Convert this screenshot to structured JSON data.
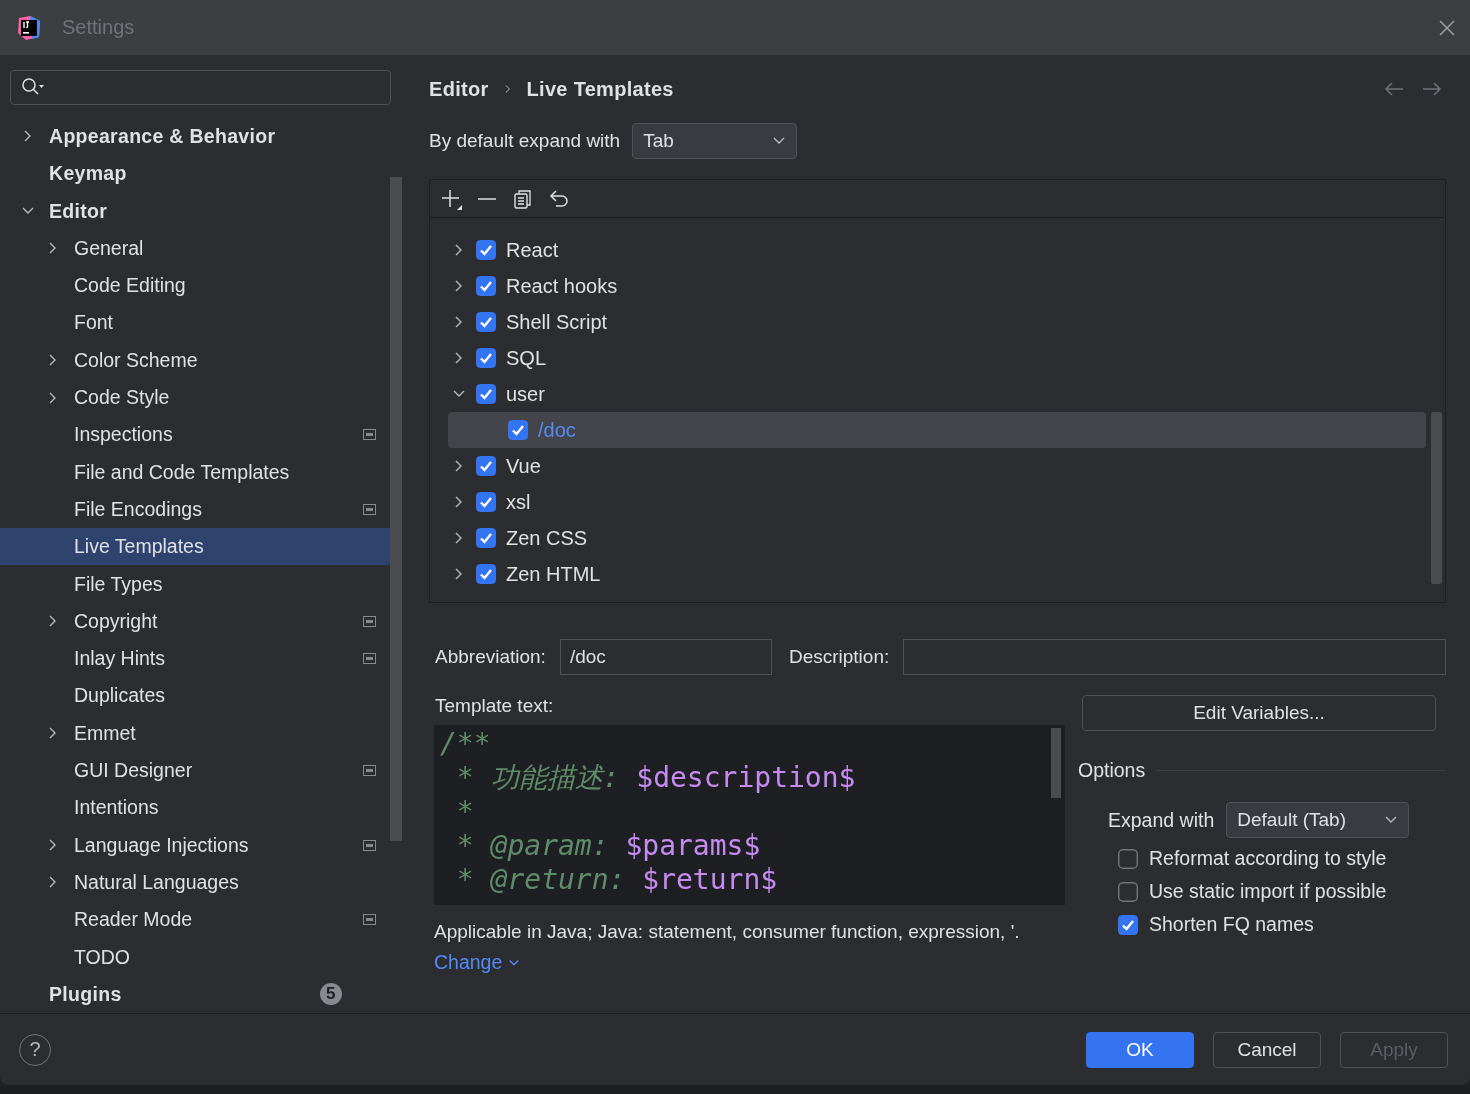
{
  "window": {
    "title": "Settings"
  },
  "sidebar": {
    "items": [
      {
        "label": "Appearance & Behavior",
        "expanded": false,
        "selected": false
      },
      {
        "label": "Keymap",
        "selected": false
      },
      {
        "label": "Editor",
        "expanded": true,
        "selected": false,
        "children": [
          {
            "label": "General",
            "expanded": false,
            "selected": false,
            "project_level": false
          },
          {
            "label": "Code Editing",
            "selected": false,
            "project_level": false
          },
          {
            "label": "Font",
            "selected": false,
            "project_level": false
          },
          {
            "label": "Color Scheme",
            "expanded": false,
            "selected": false,
            "project_level": false
          },
          {
            "label": "Code Style",
            "expanded": false,
            "selected": false,
            "project_level": false
          },
          {
            "label": "Inspections",
            "selected": false,
            "project_level": true
          },
          {
            "label": "File and Code Templates",
            "selected": false,
            "project_level": false
          },
          {
            "label": "File Encodings",
            "selected": false,
            "project_level": true
          },
          {
            "label": "Live Templates",
            "selected": true,
            "project_level": false
          },
          {
            "label": "File Types",
            "selected": false,
            "project_level": false
          },
          {
            "label": "Copyright",
            "expanded": false,
            "selected": false,
            "project_level": true
          },
          {
            "label": "Inlay Hints",
            "selected": false,
            "project_level": true
          },
          {
            "label": "Duplicates",
            "selected": false,
            "project_level": false
          },
          {
            "label": "Emmet",
            "expanded": false,
            "selected": false,
            "project_level": false
          },
          {
            "label": "GUI Designer",
            "selected": false,
            "project_level": true
          },
          {
            "label": "Intentions",
            "selected": false,
            "project_level": false
          },
          {
            "label": "Language Injections",
            "expanded": false,
            "selected": false,
            "project_level": true
          },
          {
            "label": "Natural Languages",
            "expanded": false,
            "selected": false,
            "project_level": false
          },
          {
            "label": "Reader Mode",
            "selected": false,
            "project_level": true
          },
          {
            "label": "TODO",
            "selected": false,
            "project_level": false
          }
        ]
      },
      {
        "label": "Plugins",
        "selected": false,
        "badge": "5"
      }
    ]
  },
  "breadcrumb": [
    "Editor",
    "Live Templates"
  ],
  "expand_default": {
    "label": "By default expand with",
    "value": "Tab"
  },
  "templates": [
    {
      "label": "React",
      "checked": true,
      "expanded": false,
      "selected": false
    },
    {
      "label": "React hooks",
      "checked": true,
      "expanded": false,
      "selected": false
    },
    {
      "label": "Shell Script",
      "checked": true,
      "expanded": false,
      "selected": false
    },
    {
      "label": "SQL",
      "checked": true,
      "expanded": false,
      "selected": false
    },
    {
      "label": "user",
      "checked": true,
      "expanded": true,
      "selected": false,
      "children": [
        {
          "label": "/doc",
          "checked": true,
          "selected": true
        }
      ]
    },
    {
      "label": "Vue",
      "checked": true,
      "expanded": false,
      "selected": false
    },
    {
      "label": "xsl",
      "checked": true,
      "expanded": false,
      "selected": false
    },
    {
      "label": "Zen CSS",
      "checked": true,
      "expanded": false,
      "selected": false
    },
    {
      "label": "Zen HTML",
      "checked": true,
      "expanded": false,
      "selected": false
    }
  ],
  "abbreviation": {
    "label": "Abbreviation:",
    "value": "/doc"
  },
  "description": {
    "label": "Description:"
  },
  "template_text": {
    "label": "Template text:",
    "lines": [
      [
        {
          "kind": "comment",
          "text": "/**"
        }
      ],
      [
        {
          "kind": "comment",
          "text": " * 功能描述: "
        },
        {
          "kind": "variable",
          "text": "$description$"
        }
      ],
      [
        {
          "kind": "comment",
          "text": " *"
        }
      ],
      [
        {
          "kind": "comment",
          "text": " * @param: "
        },
        {
          "kind": "variable",
          "text": "$params$"
        }
      ],
      [
        {
          "kind": "comment",
          "text": " * @return: "
        },
        {
          "kind": "variable",
          "text": "$return$"
        }
      ]
    ]
  },
  "edit_variables": "Edit Variables...",
  "options": {
    "title": "Options",
    "expand_label": "Expand with",
    "expand_value": "Default (Tab)",
    "checkboxes": [
      {
        "label": "Reformat according to style",
        "checked": false
      },
      {
        "label": "Use static import if possible",
        "checked": false
      },
      {
        "label": "Shorten FQ names",
        "checked": true
      }
    ]
  },
  "applicable": "Applicable in Java; Java: statement, consumer function, expression, '.",
  "change_link": "Change",
  "help": "?",
  "buttons": [
    {
      "label": "OK",
      "kind": "primary",
      "disabled": false
    },
    {
      "label": "Cancel",
      "kind": "normal",
      "disabled": false
    },
    {
      "label": "Apply",
      "kind": "normal",
      "disabled": true
    }
  ]
}
